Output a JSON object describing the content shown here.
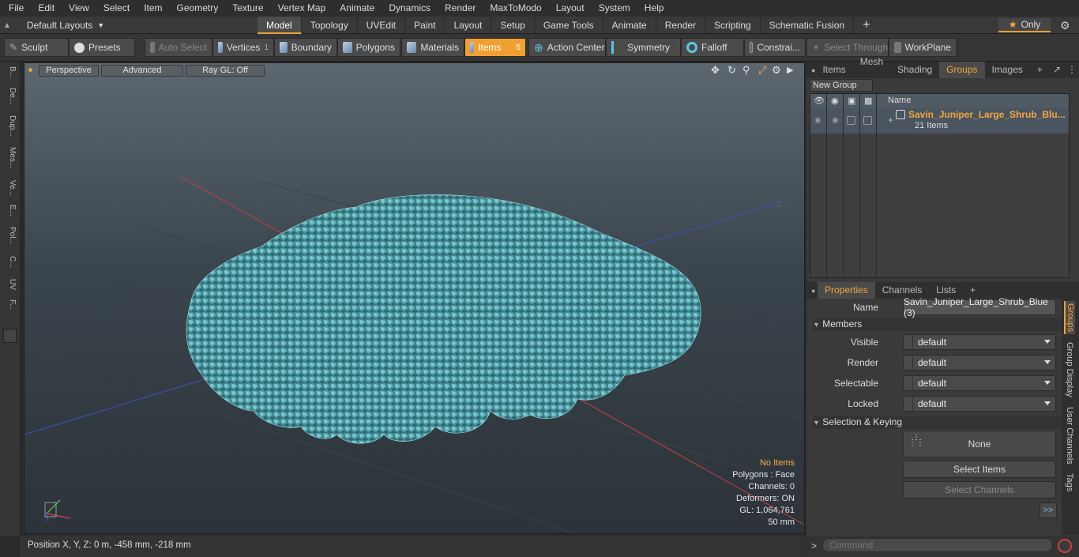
{
  "menubar": [
    "File",
    "Edit",
    "View",
    "Select",
    "Item",
    "Geometry",
    "Texture",
    "Vertex Map",
    "Animate",
    "Dynamics",
    "Render",
    "MaxToModo",
    "Layout",
    "System",
    "Help"
  ],
  "layout_dropdown": "Default Layouts",
  "tabs": [
    "Model",
    "Topology",
    "UVEdit",
    "Paint",
    "Layout",
    "Setup",
    "Game Tools",
    "Animate",
    "Render",
    "Scripting",
    "Schematic Fusion"
  ],
  "active_tab": "Model",
  "only_label": "Only",
  "toolbar": {
    "sculpt": "Sculpt",
    "presets": "Presets",
    "auto_select": "Auto Select",
    "vertices": "Vertices",
    "vertices_count": "1",
    "boundary": "Boundary",
    "polygons": "Polygons",
    "materials": "Materials",
    "items": "Items",
    "items_count": "5",
    "action_center": "Action Center",
    "symmetry": "Symmetry",
    "falloff": "Falloff",
    "constraints": "Constrai...",
    "select_through": "Select Through",
    "workplane": "WorkPlane"
  },
  "left_tabs": [
    "B...",
    "De...",
    "Dup...",
    "Mes...",
    "Ve...",
    "E...",
    "Pol...",
    "C...",
    "UV",
    "F..."
  ],
  "viewport": {
    "perspective": "Perspective",
    "advanced": "Advanced",
    "raygl": "Ray GL: Off",
    "info": {
      "no_items": "No Items",
      "polygons": "Polygons : Face",
      "channels": "Channels: 0",
      "deformers": "Deformers: ON",
      "gl": "GL: 1,064,761",
      "scale": "50 mm"
    }
  },
  "status": "Position X, Y, Z:   0 m, -458 mm, -218 mm",
  "top_panel": {
    "tabs": [
      "Items",
      "Mesh ...",
      "Shading",
      "Groups",
      "Images"
    ],
    "active": "Groups",
    "new_group": "New Group",
    "name_col": "Name",
    "group_name": "Savin_Juniper_Large_Shrub_Blu...",
    "group_count": "21 Items"
  },
  "properties": {
    "tabs": [
      "Properties",
      "Channels",
      "Lists"
    ],
    "active": "Properties",
    "name_label": "Name",
    "name_value": "Savin_Juniper_Large_Shrub_Blue (3)",
    "members": "Members",
    "visible_label": "Visible",
    "visible_value": "default",
    "render_label": "Render",
    "render_value": "default",
    "selectable_label": "Selectable",
    "selectable_value": "default",
    "locked_label": "Locked",
    "locked_value": "default",
    "selection_keying": "Selection & Keying",
    "none": "None",
    "select_items": "Select Items",
    "select_channels": "Select Channels",
    "more": ">>",
    "side_tabs": [
      "Groups",
      "Group Display",
      "User Channels",
      "Tags"
    ]
  },
  "command_placeholder": "Command"
}
